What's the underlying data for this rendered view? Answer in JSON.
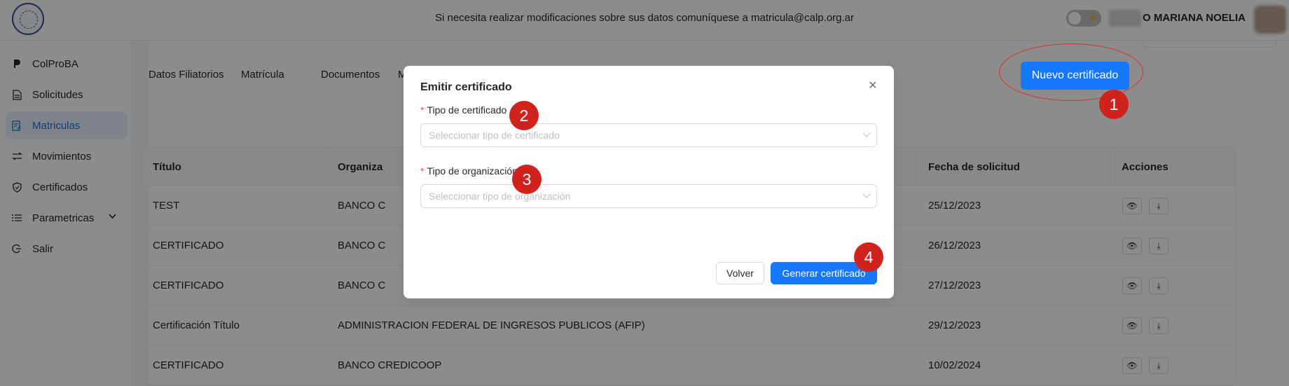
{
  "header": {
    "notice": "Si necesita realizar modificaciones sobre sus datos comuníquese a matricula@calp.org.ar",
    "user_name": "O MARIANA NOELIA",
    "theme_icon": "sun-icon"
  },
  "sidebar": {
    "items": [
      {
        "label": "ColProBA",
        "icon": "brand-icon"
      },
      {
        "label": "Solicitudes",
        "icon": "document-icon"
      },
      {
        "label": "Matriculas",
        "icon": "register-icon",
        "active": true
      },
      {
        "label": "Movimientos",
        "icon": "swap-icon"
      },
      {
        "label": "Certificados",
        "icon": "shield-check-icon"
      },
      {
        "label": "Parametricas",
        "icon": "list-icon",
        "has_submenu": true
      },
      {
        "label": "Salir",
        "icon": "logout-icon"
      }
    ]
  },
  "main": {
    "tabs": [
      "Datos Filiatorios",
      "Matrícula",
      "Documentos",
      "M"
    ],
    "new_button": "Nuevo certificado",
    "table": {
      "columns": [
        "Título",
        "Organiza",
        "Fecha de solicitud",
        "Acciones"
      ],
      "rows": [
        {
          "titulo": "TEST",
          "organizacion": "BANCO C",
          "fecha": "25/12/2023"
        },
        {
          "titulo": "CERTIFICADO",
          "organizacion": "BANCO C",
          "fecha": "26/12/2023"
        },
        {
          "titulo": "CERTIFICADO",
          "organizacion": "BANCO C",
          "fecha": "27/12/2023"
        },
        {
          "titulo": "Certificación Título",
          "organizacion": "ADMINISTRACION FEDERAL DE INGRESOS PUBLICOS (AFIP)",
          "fecha": "29/12/2023"
        },
        {
          "titulo": "CERTIFICADO",
          "organizacion": "BANCO CREDICOOP",
          "fecha": "10/02/2024"
        }
      ]
    }
  },
  "modal": {
    "title": "Emitir certificado",
    "close": "×",
    "required_mark": "*",
    "field1_label": "Tipo de certificado",
    "field1_placeholder": "Seleccionar tipo de certificado",
    "field2_label": "Tipo de organización",
    "field2_placeholder": "Seleccionar tipo de organización",
    "back_button": "Volver",
    "generate_button": "Generar certificado"
  },
  "annotations": [
    "1",
    "2",
    "3",
    "4"
  ],
  "colors": {
    "primary": "#1677ff",
    "active_nav_bg": "#e6f0fb",
    "annotation_red": "#d0231e"
  }
}
